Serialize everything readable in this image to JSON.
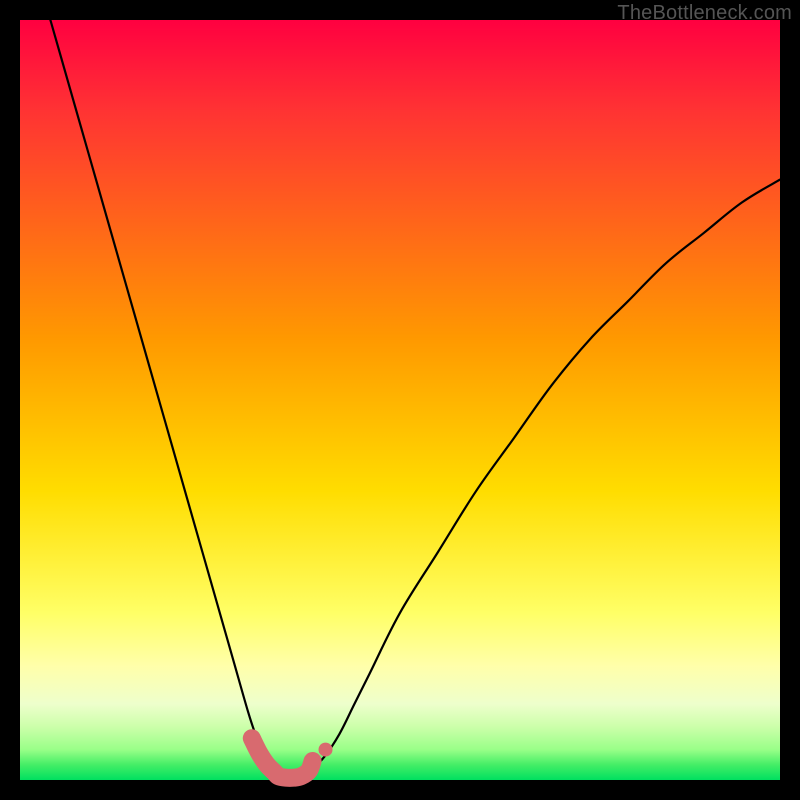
{
  "watermark": "TheBottleneck.com",
  "chart_data": {
    "type": "line",
    "title": "",
    "xlabel": "",
    "ylabel": "",
    "xlim": [
      0,
      100
    ],
    "ylim": [
      0,
      100
    ],
    "series": [
      {
        "name": "bottleneck-curve",
        "x": [
          4,
          6,
          8,
          10,
          12,
          14,
          16,
          18,
          20,
          22,
          24,
          26,
          28,
          30,
          31,
          32,
          33,
          34,
          35,
          36,
          37,
          38,
          40,
          42,
          44,
          46,
          50,
          55,
          60,
          65,
          70,
          75,
          80,
          85,
          90,
          95,
          100
        ],
        "y": [
          100,
          93,
          86,
          79,
          72,
          65,
          58,
          51,
          44,
          37,
          30,
          23,
          16,
          9,
          6,
          4,
          2,
          1,
          0,
          0,
          0,
          1,
          3,
          6,
          10,
          14,
          22,
          30,
          38,
          45,
          52,
          58,
          63,
          68,
          72,
          76,
          79
        ]
      },
      {
        "name": "highlight-segment",
        "x": [
          30.5,
          31.5,
          32.5,
          33.5,
          34,
          35,
          36,
          37,
          38,
          38.5
        ],
        "y": [
          5.5,
          3.5,
          2.0,
          1.0,
          0.5,
          0.3,
          0.3,
          0.5,
          1.2,
          2.5
        ]
      },
      {
        "name": "highlight-dot",
        "x": [
          40.2
        ],
        "y": [
          4.0
        ]
      }
    ],
    "colors": {
      "curve": "#000000",
      "highlight": "#d86a6f",
      "background_top": "#ff0040",
      "background_bottom": "#00e060"
    }
  }
}
